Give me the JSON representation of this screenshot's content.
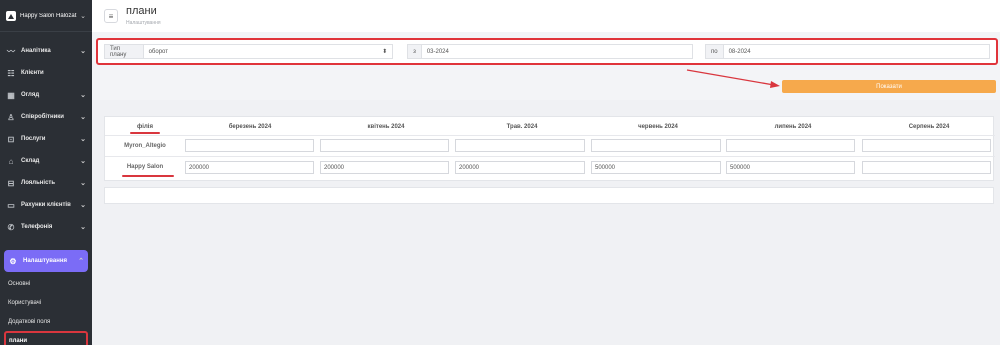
{
  "sidebar": {
    "brand": "Happy Salon Hálózat",
    "items": [
      {
        "label": "Аналітика",
        "icon": "chart-line-icon",
        "chevron": true
      },
      {
        "label": "Клієнти",
        "icon": "users-icon",
        "chevron": false
      },
      {
        "label": "Огляд",
        "icon": "grid-icon",
        "chevron": true
      },
      {
        "label": "Співробітники",
        "icon": "user-icon",
        "chevron": true
      },
      {
        "label": "Послуги",
        "icon": "services-icon",
        "chevron": true
      },
      {
        "label": "Склад",
        "icon": "warehouse-icon",
        "chevron": true
      },
      {
        "label": "Лояльність",
        "icon": "loyalty-icon",
        "chevron": true
      },
      {
        "label": "Рахунки клієнтів",
        "icon": "wallet-icon",
        "chevron": true
      },
      {
        "label": "Телефонія",
        "icon": "phone-icon",
        "chevron": true
      }
    ],
    "active": {
      "label": "Налаштування",
      "icon": "gear-icon"
    },
    "sub_items": [
      "Основні",
      "Користувачі",
      "Додаткові поля",
      "плани"
    ]
  },
  "header": {
    "title": "плани",
    "subtitle": "Налаштування"
  },
  "filter": {
    "type_label": "Тип плану",
    "type_value": "оборот",
    "from_label": "з",
    "from_value": "03-2024",
    "to_label": "по",
    "to_value": "08-2024"
  },
  "apply_label": "Показати",
  "table": {
    "branch_header": "філія",
    "months": [
      "березень 2024",
      "квітень 2024",
      "Трав. 2024",
      "червень 2024",
      "липень 2024",
      "Серпень 2024"
    ],
    "rows": [
      {
        "label": "Myron_Altegio",
        "values": [
          "",
          "",
          "",
          "",
          "",
          ""
        ]
      },
      {
        "label": "Happy Salon",
        "values": [
          "200000",
          "200000",
          "200000",
          "500000",
          "500000",
          ""
        ]
      }
    ]
  },
  "colors": {
    "accent": "#7b6cf6",
    "highlight": "#d9363e",
    "button": "#f6a94c",
    "sidebar": "#2b2f35"
  }
}
